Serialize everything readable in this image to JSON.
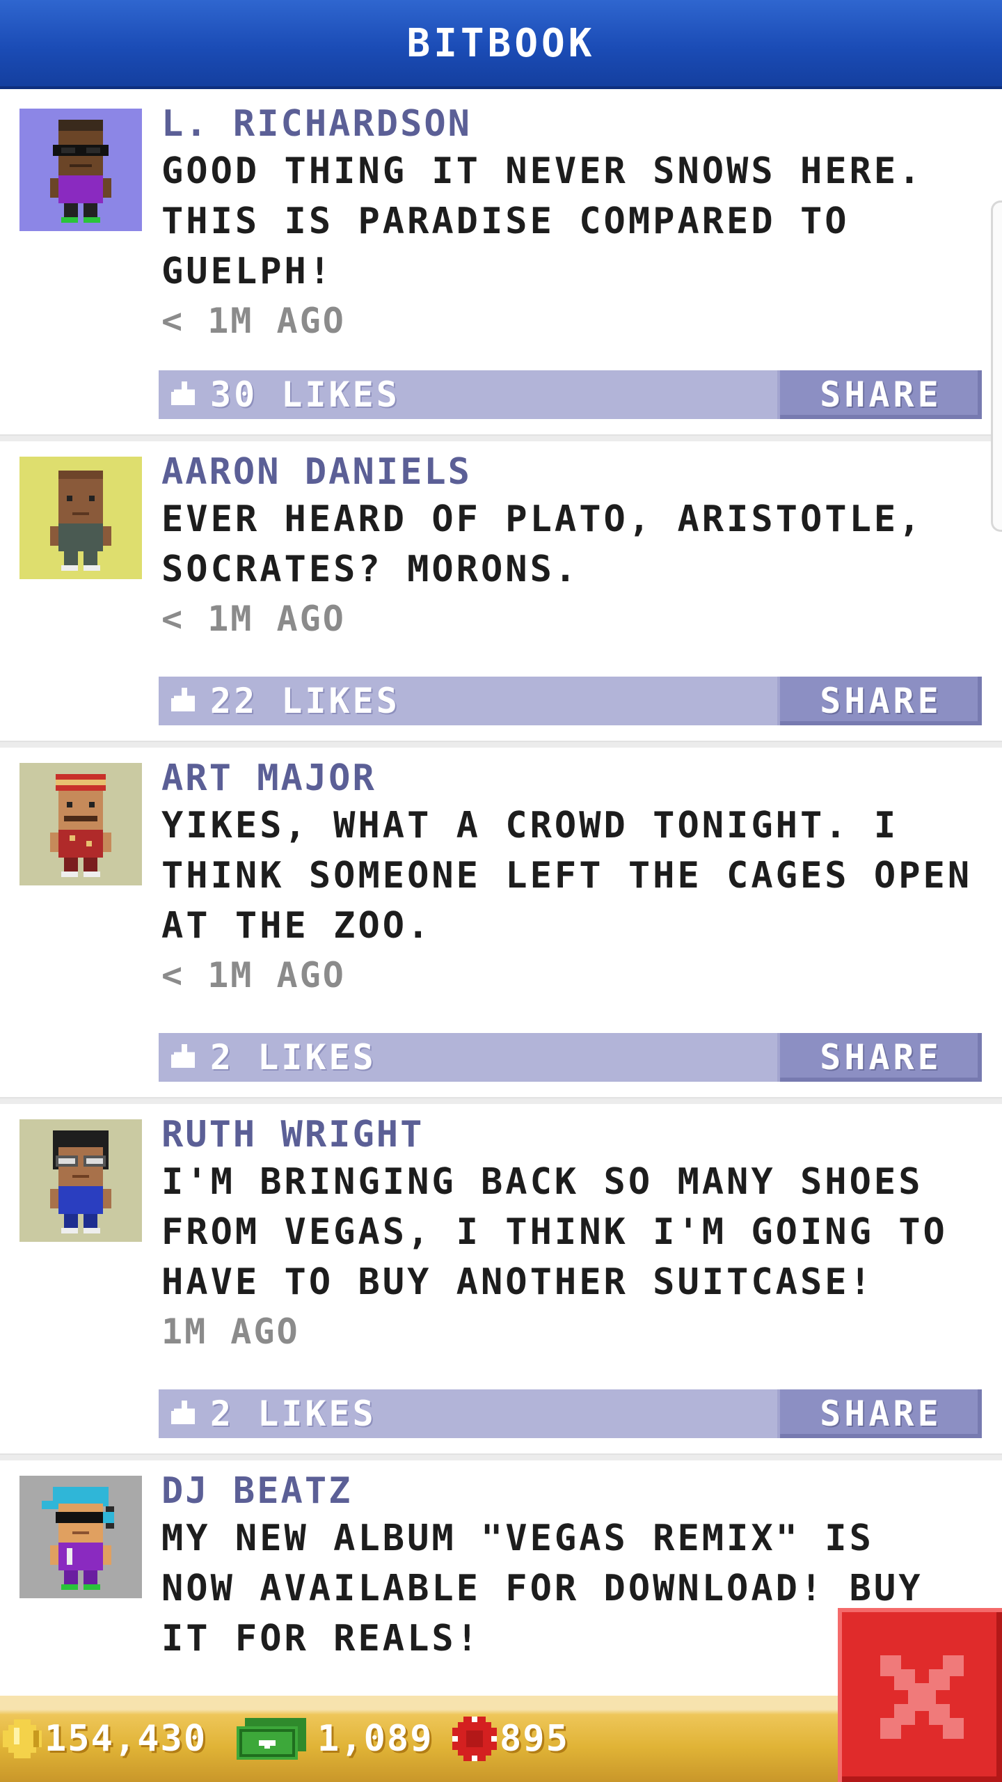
{
  "header": {
    "title": "BITBOOK"
  },
  "posts": [
    {
      "name": "L. RICHARDSON",
      "lines": [
        "GOOD THING IT NEVER SNOWS HERE.",
        "THIS IS PARADISE COMPARED TO",
        "GUELPH!"
      ],
      "time": "< 1M AGO",
      "likes": "30 LIKES",
      "share": "SHARE",
      "avatar_bg": "#8c86e6"
    },
    {
      "name": "AARON DANIELS",
      "lines": [
        "EVER HEARD OF PLATO, ARISTOTLE,",
        "SOCRATES? MORONS."
      ],
      "time": "< 1M AGO",
      "likes": "22 LIKES",
      "share": "SHARE",
      "avatar_bg": "#dede6e"
    },
    {
      "name": "ART MAJOR",
      "lines": [
        "YIKES, WHAT A CROWD TONIGHT. I",
        "THINK SOMEONE LEFT THE CAGES OPEN",
        "AT THE ZOO."
      ],
      "time": "< 1M AGO",
      "likes": "2 LIKES",
      "share": "SHARE",
      "avatar_bg": "#cacaa2"
    },
    {
      "name": "RUTH WRIGHT",
      "lines": [
        "I'M BRINGING BACK SO MANY SHOES",
        "FROM VEGAS, I THINK I'M GOING TO",
        "HAVE TO BUY ANOTHER SUITCASE!"
      ],
      "time": "1M AGO",
      "likes": "2 LIKES",
      "share": "SHARE",
      "avatar_bg": "#cacaa2"
    },
    {
      "name": "DJ BEATZ",
      "lines": [
        "MY NEW ALBUM \"VEGAS REMIX\" IS",
        "NOW AVAILABLE FOR DOWNLOAD! BUY",
        "IT FOR REALS!"
      ],
      "time": "",
      "likes": "",
      "share": "",
      "avatar_bg": "#a9a9a9"
    }
  ],
  "status_bar": {
    "coins": "154,430",
    "bux": "1,089",
    "chips": "895",
    "coin_icon": "gold-coin-icon",
    "bux_icon": "bitbux-bill-icon",
    "chip_icon": "casino-chip-icon"
  },
  "close": {
    "icon": "close-x-icon"
  },
  "colors": {
    "header": "#1b4cb6",
    "name": "#5b5f96",
    "action_bar": "#b2b4d8",
    "share_button": "#8c8fc3",
    "close_button": "#e02b2b",
    "status_bar": "#e0b336"
  }
}
